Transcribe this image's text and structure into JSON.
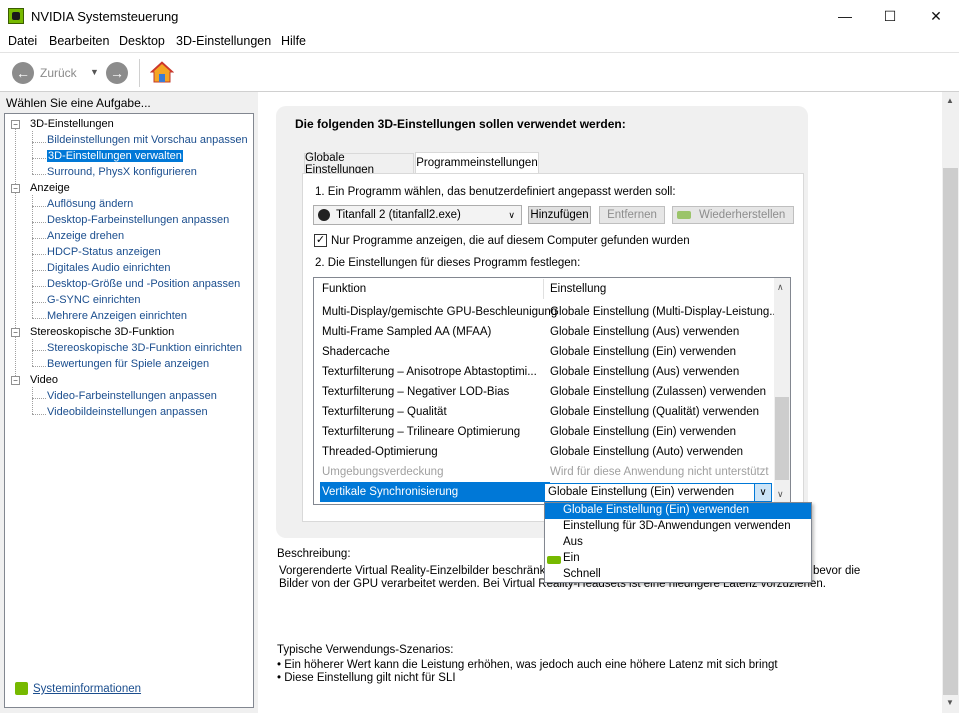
{
  "window": {
    "title": "NVIDIA Systemsteuerung",
    "minimize": "—",
    "maximize": "☐",
    "close": "✕"
  },
  "menu": [
    "Datei",
    "Bearbeiten",
    "Desktop",
    "3D-Einstellungen",
    "Hilfe"
  ],
  "toolbar": {
    "back_label": "Zurück",
    "back_icon": "arrow-left-icon",
    "forward_icon": "arrow-right-icon",
    "home_icon": "home-icon"
  },
  "sidebar": {
    "task_heading": "Wählen Sie eine Aufgabe...",
    "categories": [
      {
        "label": "3D-Einstellungen",
        "items": [
          "Bildeinstellungen mit Vorschau anpassen",
          "3D-Einstellungen verwalten",
          "Surround, PhysX konfigurieren"
        ]
      },
      {
        "label": "Anzeige",
        "items": [
          "Auflösung ändern",
          "Desktop-Farbeinstellungen anpassen",
          "Anzeige drehen",
          "HDCP-Status anzeigen",
          "Digitales Audio einrichten",
          "Desktop-Größe und -Position anpassen",
          "G-SYNC einrichten",
          "Mehrere Anzeigen einrichten"
        ]
      },
      {
        "label": "Stereoskopische 3D-Funktion",
        "items": [
          "Stereoskopische 3D-Funktion einrichten",
          "Bewertungen für Spiele anzeigen"
        ]
      },
      {
        "label": "Video",
        "items": [
          "Video-Farbeinstellungen anpassen",
          "Videobildeinstellungen anpassen"
        ]
      }
    ],
    "selected_item": "3D-Einstellungen verwalten",
    "sysinfo_label": "Systeminformationen"
  },
  "main": {
    "heading": "Die folgenden 3D-Einstellungen sollen verwendet werden:",
    "tabs": [
      {
        "label": "Globale Einstellungen",
        "active": false
      },
      {
        "label": "Programmeinstellungen",
        "active": true
      }
    ],
    "step1_label": "1. Ein Programm wählen, das benutzerdefiniert angepasst werden soll:",
    "program_value": "Titanfall 2 (titanfall2.exe)",
    "buttons": {
      "add": "Hinzufügen",
      "remove": "Entfernen",
      "restore": "Wiederherstellen"
    },
    "checkbox_label": "Nur Programme anzeigen, die auf diesem Computer gefunden wurden",
    "checkbox_checked": true,
    "step2_label": "2. Die Einstellungen für dieses Programm festlegen:",
    "columns": {
      "function": "Funktion",
      "setting": "Einstellung"
    },
    "rows": [
      {
        "function": "Multi-Display/gemischte GPU-Beschleunigung",
        "setting": "Globale Einstellung (Multi-Display-Leistung..."
      },
      {
        "function": "Multi-Frame Sampled AA (MFAA)",
        "setting": "Globale Einstellung (Aus) verwenden"
      },
      {
        "function": "Shadercache",
        "setting": "Globale Einstellung (Ein) verwenden"
      },
      {
        "function": "Texturfilterung – Anisotrope Abtastoptimi...",
        "setting": "Globale Einstellung (Aus) verwenden"
      },
      {
        "function": "Texturfilterung – Negativer LOD-Bias",
        "setting": "Globale Einstellung (Zulassen) verwenden"
      },
      {
        "function": "Texturfilterung – Qualität",
        "setting": "Globale Einstellung (Qualität) verwenden"
      },
      {
        "function": "Texturfilterung – Trilineare Optimierung",
        "setting": "Globale Einstellung (Ein) verwenden"
      },
      {
        "function": "Threaded-Optimierung",
        "setting": "Globale Einstellung (Auto) verwenden"
      },
      {
        "function": "Umgebungsverdeckung",
        "setting": "Wird für diese Anwendung nicht unterstützt"
      },
      {
        "function": "Vertikale Synchronisierung",
        "setting": "Globale Einstellung (Ein) verwenden"
      }
    ],
    "dropdown_options": [
      "Globale Einstellung (Ein) verwenden",
      "Einstellung für 3D-Anwendungen verwenden",
      "Aus",
      "Ein",
      "Schnell"
    ],
    "description_label": "Beschreibung:",
    "description_line1_start": "Vorgerenderte Virtual Reality-Einzelbilder beschränkt di",
    "description_line1_end": "bevor die",
    "description_line2": "Bilder von der GPU verarbeitet werden. Bei Virtual Reality-Headsets ist eine niedrigere Latenz vorzuziehen.",
    "usage_label": "Typische Verwendungs-Szenarios:",
    "usage_items": [
      "Ein höherer Wert kann die Leistung erhöhen, was jedoch auch eine höhere Latenz mit sich bringt",
      "Diese Einstellung gilt nicht für SLI"
    ]
  },
  "colors": {
    "accent": "#0078d7",
    "nvidia_green": "#76b900",
    "link": "#1b4e8e"
  }
}
